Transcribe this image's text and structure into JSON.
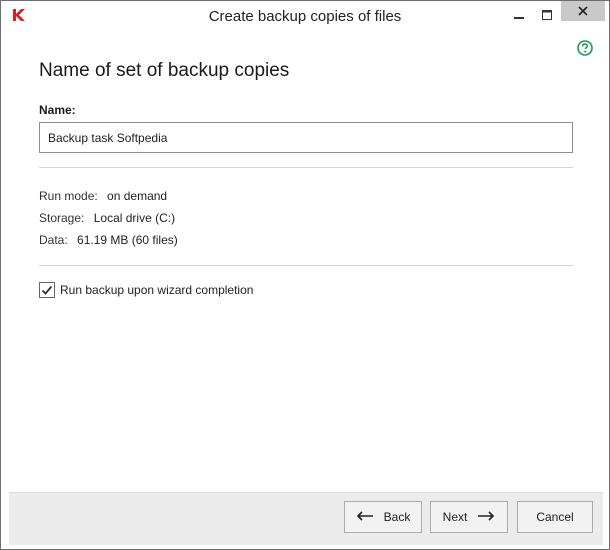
{
  "window": {
    "title": "Create backup copies of files",
    "accent_color": "#d61f26",
    "help_color": "#1c9b4f"
  },
  "page": {
    "heading": "Name of set of backup copies",
    "name_label": "Name:",
    "name_value": "Backup task Softpedia"
  },
  "info": {
    "run_mode_label": "Run mode:",
    "run_mode_value": "on demand",
    "storage_label": "Storage:",
    "storage_value": "Local drive (C:)",
    "data_label": "Data:",
    "data_value": "61.19 MB (60 files)"
  },
  "options": {
    "run_backup_label": "Run backup upon wizard completion",
    "run_backup_checked": true
  },
  "footer": {
    "back_label": "Back",
    "next_label": "Next",
    "cancel_label": "Cancel"
  },
  "icons": {
    "app": "kaspersky-logo-icon",
    "help": "help-icon",
    "back": "arrow-left-icon",
    "next": "arrow-right-icon",
    "check": "checkmark-icon"
  }
}
